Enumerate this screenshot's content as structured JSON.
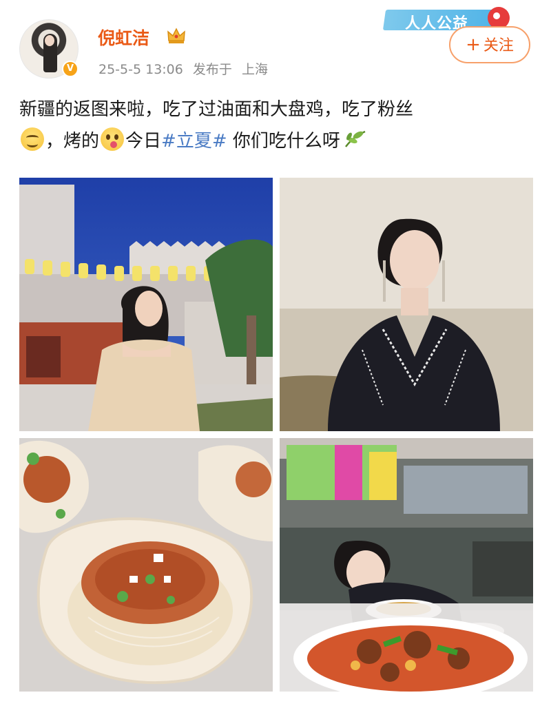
{
  "post": {
    "author": {
      "name": "倪虹洁",
      "verified_badge": "V"
    },
    "date": "25-5-5 13:06",
    "published_label": "发布于",
    "location": "上海",
    "follow_button": {
      "plus": "+",
      "label": "关注"
    },
    "promo_label": "人人公益",
    "text": {
      "line1": "新疆的返图来啦，吃了过油面和大盘鸡，吃了粉丝",
      "part2": "，烤的",
      "part3": "今日",
      "hashtag": "#立夏#",
      "part4": " 你们吃什么呀"
    },
    "emojis": [
      "smile-emoji",
      "yum-emoji",
      "leaf-icon"
    ],
    "photos": [
      {
        "name": "photo-woman-bazaar-night"
      },
      {
        "name": "photo-woman-black-jacket"
      },
      {
        "name": "photo-grilled-scallops-vermicelli"
      },
      {
        "name": "photo-woman-restaurant-dapanji"
      }
    ]
  },
  "colors": {
    "username": "#ea5a16",
    "hashtag": "#4a7bc4",
    "meta": "#8a8a8a",
    "follow_border": "#f7a06a"
  }
}
